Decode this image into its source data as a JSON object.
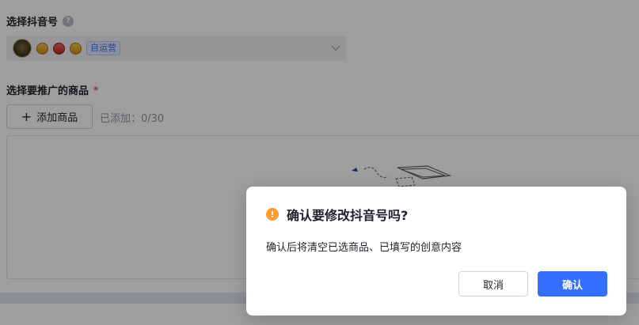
{
  "account": {
    "section_title": "选择抖音号",
    "help_icon_glyph": "?",
    "tag": "自运营"
  },
  "products": {
    "section_title": "选择要推广的商品",
    "required_mark": "*",
    "add_button_label": "添加商品",
    "plus_glyph": "+",
    "added_count": "已添加：0/30"
  },
  "dialog": {
    "warning_glyph": "!",
    "title": "确认要修改抖音号吗?",
    "message": "确认后将清空已选商品、已填写的创意内容",
    "cancel_label": "取消",
    "confirm_label": "确认"
  },
  "colors": {
    "primary": "#3370ff",
    "warning": "#ff9a2e",
    "required": "#f54a45"
  }
}
